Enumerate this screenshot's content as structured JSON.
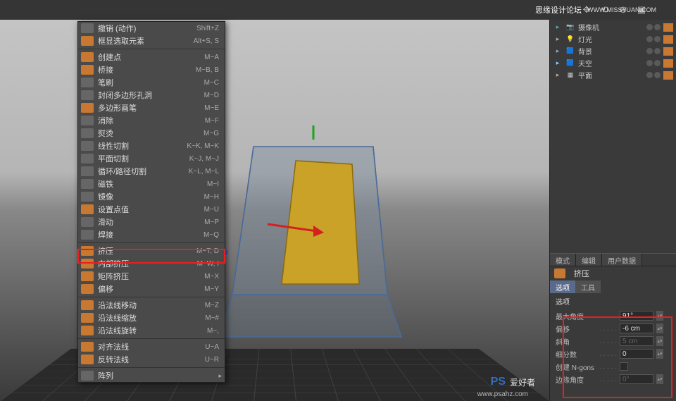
{
  "watermarks": {
    "top_right": "思缘设计论坛",
    "top_right_url": "WWW.MISSYUAN.COM",
    "bottom_brand": "爱好者",
    "bottom_url": "www.psahz.com"
  },
  "viewport_icons": [
    "move-icon",
    "rotate-icon",
    "zoom-icon",
    "frame-icon"
  ],
  "menu": [
    {
      "icon": "gray",
      "label": "撤销 (动作)",
      "shortcut": "Shift+Z"
    },
    {
      "icon": "orange",
      "label": "框显选取元素",
      "shortcut": "Alt+S, S"
    },
    {
      "sep": true
    },
    {
      "icon": "orange",
      "label": "创建点",
      "shortcut": "M~A"
    },
    {
      "icon": "orange",
      "label": "桥接",
      "shortcut": "M~B, B"
    },
    {
      "icon": "gray",
      "label": "笔刷",
      "shortcut": "M~C"
    },
    {
      "icon": "gray",
      "label": "封闭多边形孔洞",
      "shortcut": "M~D"
    },
    {
      "icon": "orange",
      "label": "多边形画笔",
      "shortcut": "M~E"
    },
    {
      "icon": "gray",
      "label": "消除",
      "shortcut": "M~F"
    },
    {
      "icon": "gray",
      "label": "熨烫",
      "shortcut": "M~G"
    },
    {
      "icon": "gray",
      "label": "线性切割",
      "shortcut": "K~K, M~K"
    },
    {
      "icon": "gray",
      "label": "平面切割",
      "shortcut": "K~J, M~J"
    },
    {
      "icon": "gray",
      "label": "循环/路径切割",
      "shortcut": "K~L, M~L"
    },
    {
      "icon": "gray",
      "label": "磁铁",
      "shortcut": "M~I"
    },
    {
      "icon": "gray",
      "label": "镜像",
      "shortcut": "M~H"
    },
    {
      "icon": "orange",
      "label": "设置点值",
      "shortcut": "M~U"
    },
    {
      "icon": "gray",
      "label": "滑动",
      "shortcut": "M~P"
    },
    {
      "icon": "gray",
      "label": "焊接",
      "shortcut": "M~Q"
    },
    {
      "sep": true
    },
    {
      "icon": "orange",
      "label": "挤压",
      "shortcut": "M~T, D",
      "highlight": true
    },
    {
      "icon": "orange",
      "label": "内部挤压",
      "shortcut": "M~W, I"
    },
    {
      "icon": "orange",
      "label": "矩阵挤压",
      "shortcut": "M~X"
    },
    {
      "icon": "orange",
      "label": "偏移",
      "shortcut": "M~Y"
    },
    {
      "sep": true
    },
    {
      "icon": "orange",
      "label": "沿法线移动",
      "shortcut": "M~Z"
    },
    {
      "icon": "orange",
      "label": "沿法线缩放",
      "shortcut": "M~#"
    },
    {
      "icon": "orange",
      "label": "沿法线旋转",
      "shortcut": "M~,"
    },
    {
      "sep": true
    },
    {
      "icon": "orange",
      "label": "对齐法线",
      "shortcut": "U~A"
    },
    {
      "icon": "orange",
      "label": "反转法线",
      "shortcut": "U~R"
    },
    {
      "sep": true
    },
    {
      "icon": "gray",
      "label": "阵列",
      "shortcut": "",
      "arrow": true
    }
  ],
  "objects": [
    {
      "icon": "📷",
      "name": "摄像机",
      "color": "#5aa"
    },
    {
      "icon": "💡",
      "name": "灯光",
      "color": "#aaa"
    },
    {
      "icon": "🟦",
      "name": "背景",
      "color": "#8ab"
    },
    {
      "icon": "🟦",
      "name": "天空",
      "color": "#8cf"
    },
    {
      "icon": "▦",
      "name": "平面",
      "color": "#aaa"
    }
  ],
  "attr": {
    "tabs": [
      "模式",
      "编辑",
      "用户数据"
    ],
    "tool_name": "挤压",
    "subtabs": [
      "选项",
      "工具"
    ],
    "section": "选项",
    "rows": [
      {
        "label": "最大角度",
        "value": "91°"
      },
      {
        "label": "偏移",
        "value": "-6 cm"
      },
      {
        "label": "斜角",
        "value": "5 cm",
        "disabled": true
      },
      {
        "label": "细分数",
        "value": "0"
      },
      {
        "label": "创建 N-gons",
        "check": true
      },
      {
        "label": "边缘角度",
        "value": "0°",
        "disabled": true
      }
    ]
  }
}
